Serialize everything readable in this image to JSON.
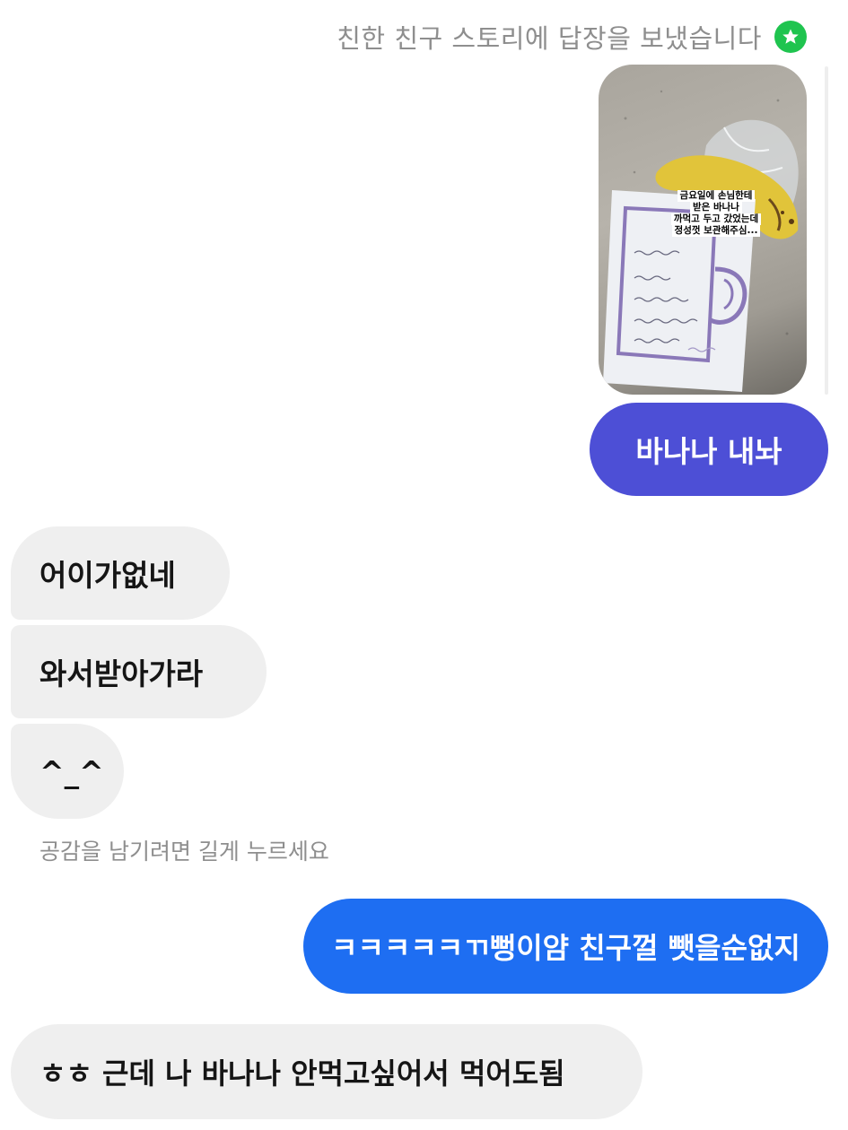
{
  "story_reply": {
    "header_text": "친한 친구 스토리에 답장을 보냈습니다",
    "badge_icon": "star-icon",
    "badge_color": "#1fc44f",
    "caption_lines": [
      "금요일에 손님한테",
      "받은 바나나",
      "까먹고 두고 갔었는데",
      "정성껏 보관해주심..."
    ]
  },
  "messages": [
    {
      "id": "m1",
      "direction": "sent",
      "text": "바나나 내놔",
      "color": "#4d4fd6"
    },
    {
      "id": "m2",
      "direction": "received",
      "text": "어이가없네"
    },
    {
      "id": "m3",
      "direction": "received",
      "text": "와서받아가라"
    },
    {
      "id": "m4",
      "direction": "received",
      "text": "^_^"
    },
    {
      "id": "m5",
      "direction": "sent",
      "text": "ㅋㅋㅋㅋㅋㄲ뻥이얌 친구껄 뺏을순없지",
      "color": "#1e6ef2"
    },
    {
      "id": "m6",
      "direction": "received",
      "text": "ㅎㅎ 근데 나 바나나 안먹고싶어서 먹어도됨"
    }
  ],
  "reaction_hint": "공감을 남기려면 길게 누르세요"
}
